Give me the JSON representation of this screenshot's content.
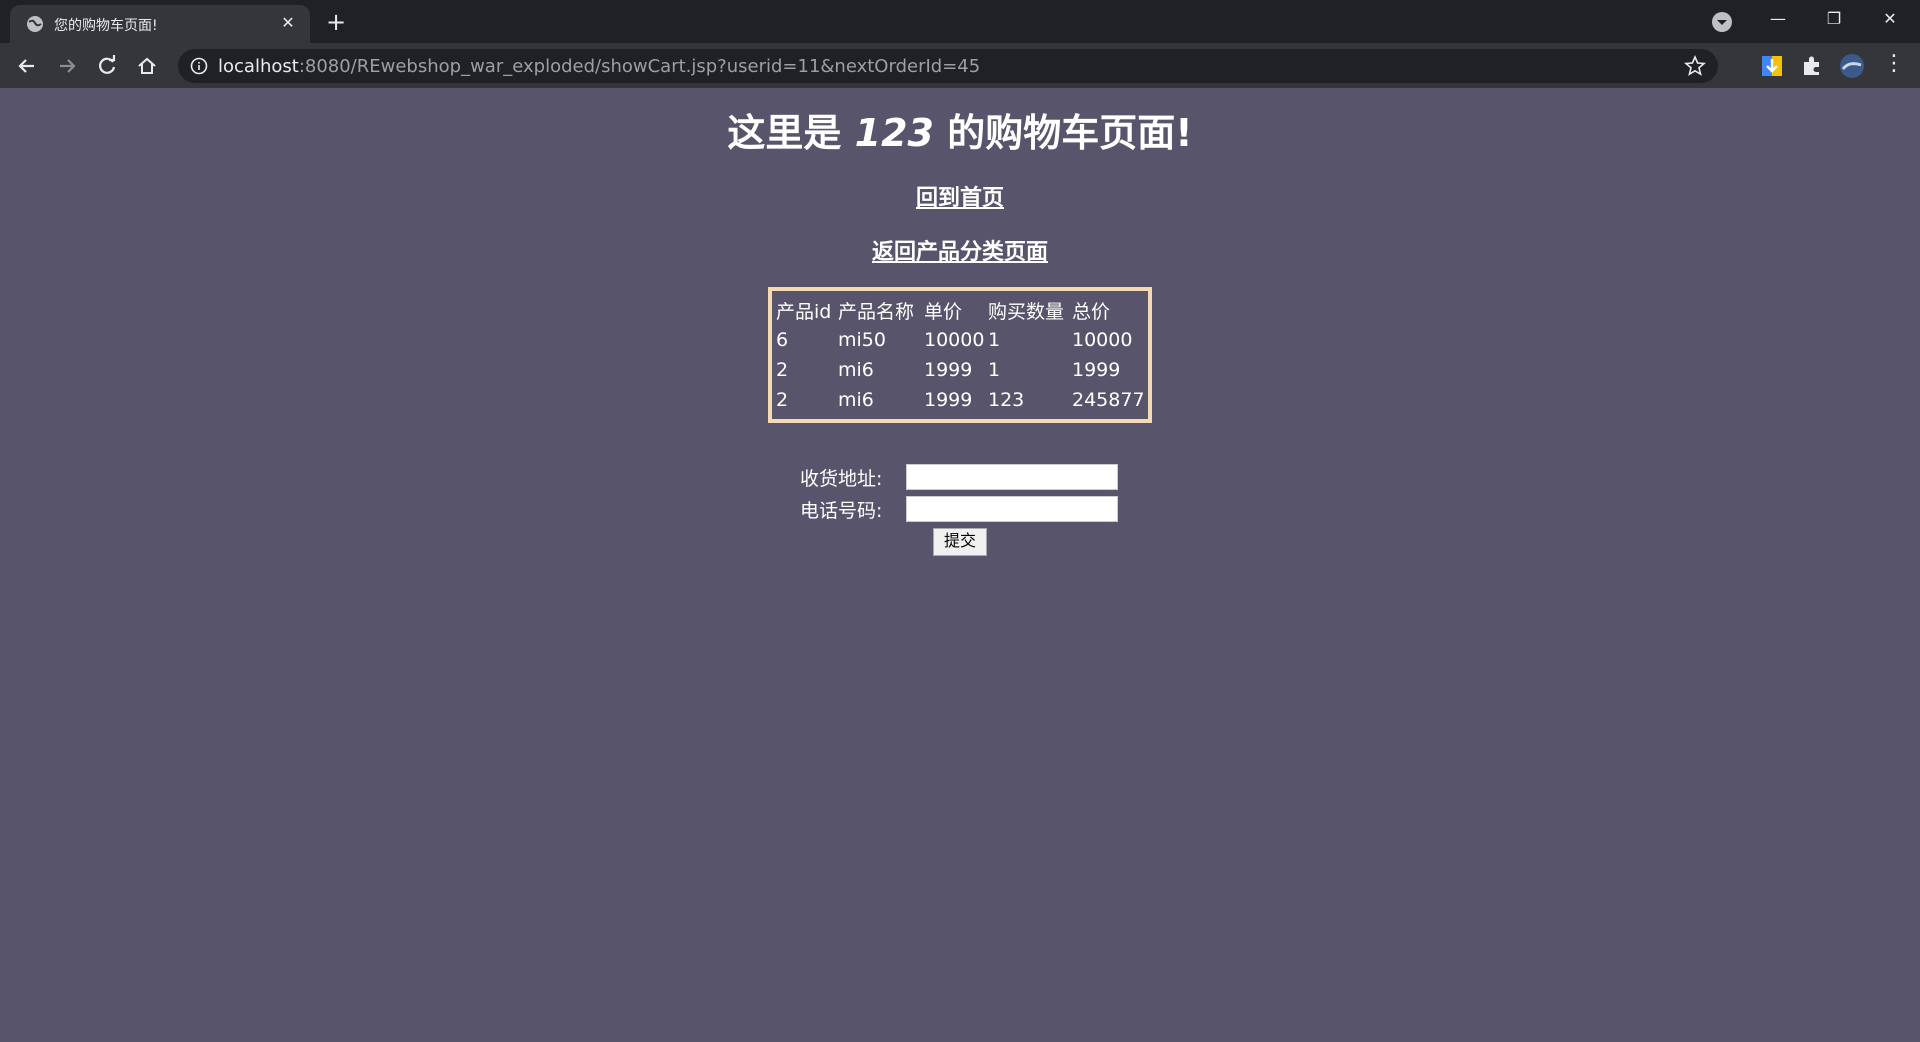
{
  "browser": {
    "tab_title": "您的购物车页面!",
    "url_host": "localhost",
    "url_rest": ":8080/REwebshop_war_exploded/showCart.jsp?userid=11&nextOrderId=45"
  },
  "page": {
    "title_prefix": "这里是",
    "title_user": "123",
    "title_suffix": "的购物车页面!",
    "home_link": "回到首页",
    "category_link": "返回产品分类页面"
  },
  "cart": {
    "headers": [
      "产品id",
      "产品名称",
      "单价",
      "购买数量",
      "总价"
    ],
    "rows": [
      [
        "6",
        "mi50",
        "10000",
        "1",
        "10000"
      ],
      [
        "2",
        "mi6",
        "1999",
        "1",
        "1999"
      ],
      [
        "2",
        "mi6",
        "1999",
        "123",
        "245877"
      ]
    ]
  },
  "form": {
    "address_label": "收货地址:",
    "address_value": "",
    "phone_label": "电话号码:",
    "phone_value": "",
    "submit_label": "提交"
  }
}
